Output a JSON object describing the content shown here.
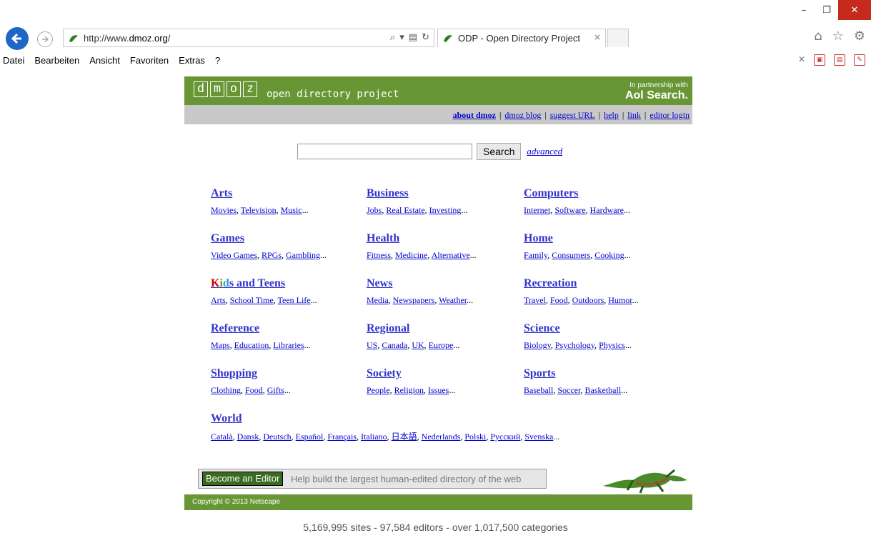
{
  "window": {
    "minimize": "–",
    "maximize": "❐",
    "close": "✕"
  },
  "browser": {
    "url_prefix": "http://www.",
    "url_domain": "dmoz.org",
    "url_suffix": "/",
    "tab_title": "ODP - Open Directory Project",
    "tab_close": "×",
    "home_icon": "⌂",
    "star_icon": "☆",
    "gear_icon": "⚙"
  },
  "menubar": [
    "Datei",
    "Bearbeiten",
    "Ansicht",
    "Favoriten",
    "Extras",
    "?"
  ],
  "site": {
    "logo_letters": [
      "d",
      "m",
      "o",
      "z"
    ],
    "tagline": "open directory project",
    "partner_line": "In partnership with",
    "partner_name": "Aol Search.",
    "top_links": [
      "about dmoz",
      "dmoz blog",
      "suggest URL",
      "help",
      "link",
      "editor login"
    ],
    "search_button": "Search",
    "search_advanced": "advanced",
    "categories": [
      {
        "title": "Arts",
        "subs": [
          "Movies",
          "Television",
          "Music"
        ]
      },
      {
        "title": "Business",
        "subs": [
          "Jobs",
          "Real Estate",
          "Investing"
        ]
      },
      {
        "title": "Computers",
        "subs": [
          "Internet",
          "Software",
          "Hardware"
        ]
      },
      {
        "title": "Games",
        "subs": [
          "Video Games",
          "RPGs",
          "Gambling"
        ]
      },
      {
        "title": "Health",
        "subs": [
          "Fitness",
          "Medicine",
          "Alternative"
        ]
      },
      {
        "title": "Home",
        "subs": [
          "Family",
          "Consumers",
          "Cooking"
        ]
      },
      {
        "title": "Kids and Teens",
        "subs": [
          "Arts",
          "School Time",
          "Teen Life"
        ]
      },
      {
        "title": "News",
        "subs": [
          "Media",
          "Newspapers",
          "Weather"
        ]
      },
      {
        "title": "Recreation",
        "subs": [
          "Travel",
          "Food",
          "Outdoors",
          "Humor"
        ]
      },
      {
        "title": "Reference",
        "subs": [
          "Maps",
          "Education",
          "Libraries"
        ]
      },
      {
        "title": "Regional",
        "subs": [
          "US",
          "Canada",
          "UK",
          "Europe"
        ]
      },
      {
        "title": "Science",
        "subs": [
          "Biology",
          "Psychology",
          "Physics"
        ]
      },
      {
        "title": "Shopping",
        "subs": [
          "Clothing",
          "Food",
          "Gifts"
        ]
      },
      {
        "title": "Society",
        "subs": [
          "People",
          "Religion",
          "Issues"
        ]
      },
      {
        "title": "Sports",
        "subs": [
          "Baseball",
          "Soccer",
          "Basketball"
        ]
      },
      {
        "title": "World",
        "subs": [
          "Català",
          "Dansk",
          "Deutsch",
          "Español",
          "Français",
          "Italiano",
          "日本語",
          "Nederlands",
          "Polski",
          "Русский",
          "Svenska"
        ]
      }
    ],
    "editor_button": "Become an Editor",
    "editor_text": "Help build the largest human-edited directory of the web",
    "copyright": "Copyright © 2013 Netscape",
    "stats": "5,169,995 sites - 97,584 editors - over 1,017,500 categories"
  },
  "colors": {
    "banner_green": "#689634",
    "link_blue": "#0000cc",
    "back_button_blue": "#1e67c8"
  }
}
